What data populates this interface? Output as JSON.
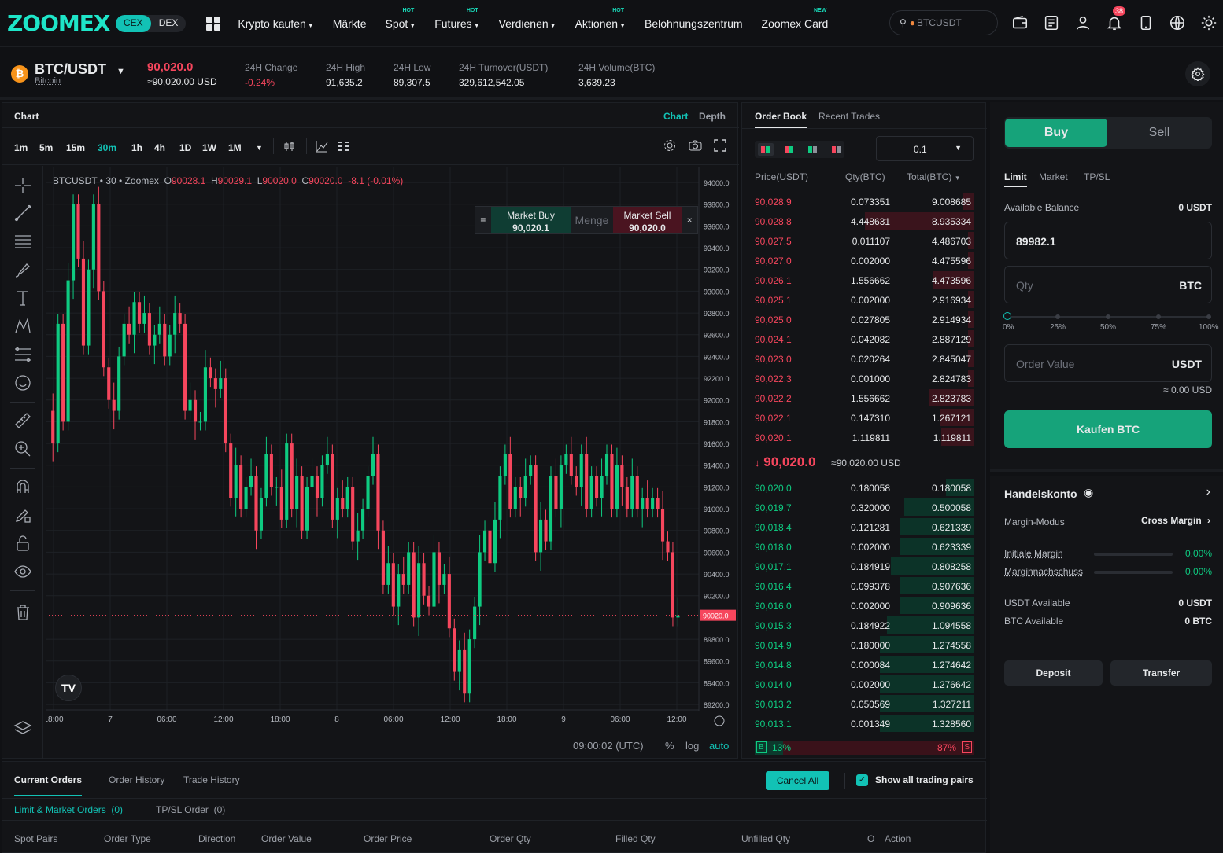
{
  "brand": {
    "logo": "ZOOMEX",
    "cex": "CEX",
    "dex": "DEX",
    "accent": "#12c2b5"
  },
  "nav": [
    {
      "label": "Krypto kaufen",
      "caret": true,
      "tag": ""
    },
    {
      "label": "Märkte",
      "caret": false,
      "tag": ""
    },
    {
      "label": "Spot",
      "caret": true,
      "tag": "HOT"
    },
    {
      "label": "Futures",
      "caret": true,
      "tag": "HOT"
    },
    {
      "label": "Verdienen",
      "caret": true,
      "tag": ""
    },
    {
      "label": "Aktionen",
      "caret": true,
      "tag": "HOT"
    },
    {
      "label": "Belohnungszentrum",
      "caret": false,
      "tag": ""
    },
    {
      "label": "Zoomex Card",
      "caret": false,
      "tag": "NEW"
    }
  ],
  "search": {
    "placeholder": "BTCUSDT"
  },
  "notifications": {
    "count": "38"
  },
  "ticker": {
    "pair": "BTC/USDT",
    "name": "Bitcoin",
    "price": "90,020.0",
    "price_usd": "≈90,020.00 USD",
    "stats": [
      {
        "label": "24H Change",
        "value": "-0.24%",
        "color": "red"
      },
      {
        "label": "24H High",
        "value": "91,635.2",
        "color": ""
      },
      {
        "label": "24H Low",
        "value": "89,307.5",
        "color": ""
      },
      {
        "label": "24H Turnover(USDT)",
        "value": "329,612,542.05",
        "color": ""
      },
      {
        "label": "24H Volume(BTC)",
        "value": "3,639.23",
        "color": ""
      }
    ]
  },
  "chart": {
    "title": "Chart",
    "tab_chart": "Chart",
    "tab_depth": "Depth",
    "timeframes": [
      "1m",
      "5m",
      "15m",
      "30m",
      "1h",
      "4h",
      "1D",
      "1W",
      "1M"
    ],
    "active_tf": "30m",
    "legend": {
      "symbol": "BTCUSDT",
      "interval": "30",
      "source": "Zoomex",
      "o": "90028.1",
      "h": "90029.1",
      "l": "90020.0",
      "c": "90020.0",
      "chg": "-8.1",
      "chgpct": "(-0.01%)"
    },
    "market_buy_label": "Market Buy",
    "market_buy_price": "90,020.1",
    "market_sell_label": "Market Sell",
    "market_sell_price": "90,020.0",
    "qty_placeholder": "Menge",
    "clock": "09:00:02 (UTC)",
    "pct": "%",
    "log": "log",
    "auto": "auto"
  },
  "chart_data": {
    "type": "candlestick",
    "y_ticks": [
      94000,
      93800,
      93600,
      93400,
      93200,
      93000,
      92800,
      92600,
      92400,
      92200,
      92000,
      91800,
      91600,
      91400,
      91200,
      91000,
      90800,
      90600,
      90400,
      90200,
      89800,
      89600,
      89400,
      89200
    ],
    "ylim": [
      89150,
      94080
    ],
    "x_ticks": [
      "18:00",
      "7",
      "06:00",
      "12:00",
      "18:00",
      "8",
      "06:00",
      "12:00",
      "18:00",
      "9",
      "06:00",
      "12:00"
    ],
    "last_price": 90020.0,
    "up_color": "#0ecb81",
    "down_color": "#f6465d",
    "closes": [
      91600,
      92700,
      91800,
      93100,
      93800,
      93300,
      92500,
      93200,
      93800,
      93000,
      92300,
      92000,
      91900,
      92400,
      92700,
      92600,
      92900,
      92700,
      92800,
      92500,
      92600,
      92700,
      92400,
      92600,
      92800,
      92700,
      91900,
      92000,
      91800,
      91800,
      92300,
      92200,
      92100,
      92200,
      91600,
      91100,
      91400,
      91000,
      91200,
      91300,
      90800,
      91100,
      91500,
      91200,
      91200,
      90900,
      91600,
      91000,
      91300,
      90800,
      91200,
      91300,
      91100,
      91400,
      91500,
      90900,
      91100,
      91000,
      91200,
      90700,
      90800,
      91000,
      91300,
      91500,
      90800,
      90300,
      90500,
      90100,
      90400,
      90300,
      90600,
      90000,
      90500,
      90200,
      90100,
      90600,
      90300,
      90400,
      89900,
      89500,
      89700,
      89300,
      89800,
      90100,
      90600,
      90800,
      90500,
      90900,
      91300,
      91500,
      91000,
      91200,
      91100,
      91300,
      91400,
      90600,
      90900,
      90700,
      91300,
      91000,
      91400,
      91500,
      91300,
      91200,
      91500,
      91000,
      91300,
      91100,
      91300,
      91500,
      91000,
      91400,
      91200,
      91000,
      91300,
      91000,
      91100,
      91000,
      91100,
      91000,
      90700,
      90600,
      90000,
      90020
    ]
  },
  "orderbook": {
    "tab_book": "Order Book",
    "tab_trades": "Recent Trades",
    "precision": "0.1",
    "col_price": "Price(USDT)",
    "col_qty": "Qty(BTC)",
    "col_total": "Total(BTC)",
    "asks": [
      [
        "90,028.9",
        "0.073351",
        "9.008685"
      ],
      [
        "90,028.8",
        "4.448631",
        "8.935334"
      ],
      [
        "90,027.5",
        "0.011107",
        "4.486703"
      ],
      [
        "90,027.0",
        "0.002000",
        "4.475596"
      ],
      [
        "90,026.1",
        "1.556662",
        "4.473596"
      ],
      [
        "90,025.1",
        "0.002000",
        "2.916934"
      ],
      [
        "90,025.0",
        "0.027805",
        "2.914934"
      ],
      [
        "90,024.1",
        "0.042082",
        "2.887129"
      ],
      [
        "90,023.0",
        "0.020264",
        "2.845047"
      ],
      [
        "90,022.3",
        "0.001000",
        "2.824783"
      ],
      [
        "90,022.2",
        "1.556662",
        "2.823783"
      ],
      [
        "90,022.1",
        "0.147310",
        "1.267121"
      ],
      [
        "90,020.1",
        "1.119811",
        "1.119811"
      ]
    ],
    "ask_depth": [
      0.05,
      0.5,
      0.03,
      0.03,
      0.19,
      0.03,
      0.03,
      0.03,
      0.03,
      0.03,
      0.21,
      0.16,
      0.15
    ],
    "mid_price": "90,020.0",
    "mid_usd": "≈90,020.00 USD",
    "bids": [
      [
        "90,020.0",
        "0.180058",
        "0.180058"
      ],
      [
        "90,019.7",
        "0.320000",
        "0.500058"
      ],
      [
        "90,018.4",
        "0.121281",
        "0.621339"
      ],
      [
        "90,018.0",
        "0.002000",
        "0.623339"
      ],
      [
        "90,017.1",
        "0.184919",
        "0.808258"
      ],
      [
        "90,016.4",
        "0.099378",
        "0.907636"
      ],
      [
        "90,016.0",
        "0.002000",
        "0.909636"
      ],
      [
        "90,015.3",
        "0.184922",
        "1.094558"
      ],
      [
        "90,014.9",
        "0.180000",
        "1.274558"
      ],
      [
        "90,014.8",
        "0.000084",
        "1.274642"
      ],
      [
        "90,014.0",
        "0.002000",
        "1.276642"
      ],
      [
        "90,013.2",
        "0.050569",
        "1.327211"
      ],
      [
        "90,013.1",
        "0.001349",
        "1.328560"
      ]
    ],
    "bid_depth": [
      0.13,
      0.32,
      0.34,
      0.34,
      0.38,
      0.34,
      0.34,
      0.4,
      0.43,
      0.43,
      0.43,
      0.43,
      0.43
    ],
    "ratio_buy": "13%",
    "ratio_sell": "87%",
    "ratio_b": "B",
    "ratio_s": "S",
    "buy_fraction": 0.13
  },
  "trade": {
    "buy": "Buy",
    "sell": "Sell",
    "tabs": [
      "Limit",
      "Market",
      "TP/SL"
    ],
    "balance_label": "Available Balance",
    "balance_value": "0 USDT",
    "price_value": "89982.1",
    "qty_placeholder": "Qty",
    "qty_unit": "BTC",
    "slider_marks": [
      "0%",
      "25%",
      "50%",
      "75%",
      "100%"
    ],
    "value_placeholder": "Order Value",
    "value_unit": "USDT",
    "value_usd": "≈ 0.00 USD",
    "submit": "Kaufen BTC"
  },
  "account": {
    "title": "Handelskonto",
    "margin_mode_label": "Margin-Modus",
    "margin_mode": "Cross Margin",
    "init_margin_label": "Initiale Margin",
    "init_margin": "0.00%",
    "maint_margin_label": "Marginnachschuss",
    "maint_margin": "0.00%",
    "usdt_label": "USDT Available",
    "usdt": "0 USDT",
    "btc_label": "BTC Available",
    "btc": "0 BTC",
    "deposit": "Deposit",
    "transfer": "Transfer"
  },
  "orders": {
    "tabs": [
      "Current Orders",
      "Order History",
      "Trade History"
    ],
    "cancel_all": "Cancel All",
    "show_all": "Show all trading pairs",
    "subtabs": [
      "Limit & Market Orders  (0)",
      "TP/SL Order  (0)"
    ],
    "columns": [
      "Spot Pairs",
      "Order Type",
      "Direction",
      "Order Value",
      "Order Price",
      "Order Qty",
      "Filled Qty",
      "Unfilled Qty",
      "O",
      "Action"
    ]
  }
}
